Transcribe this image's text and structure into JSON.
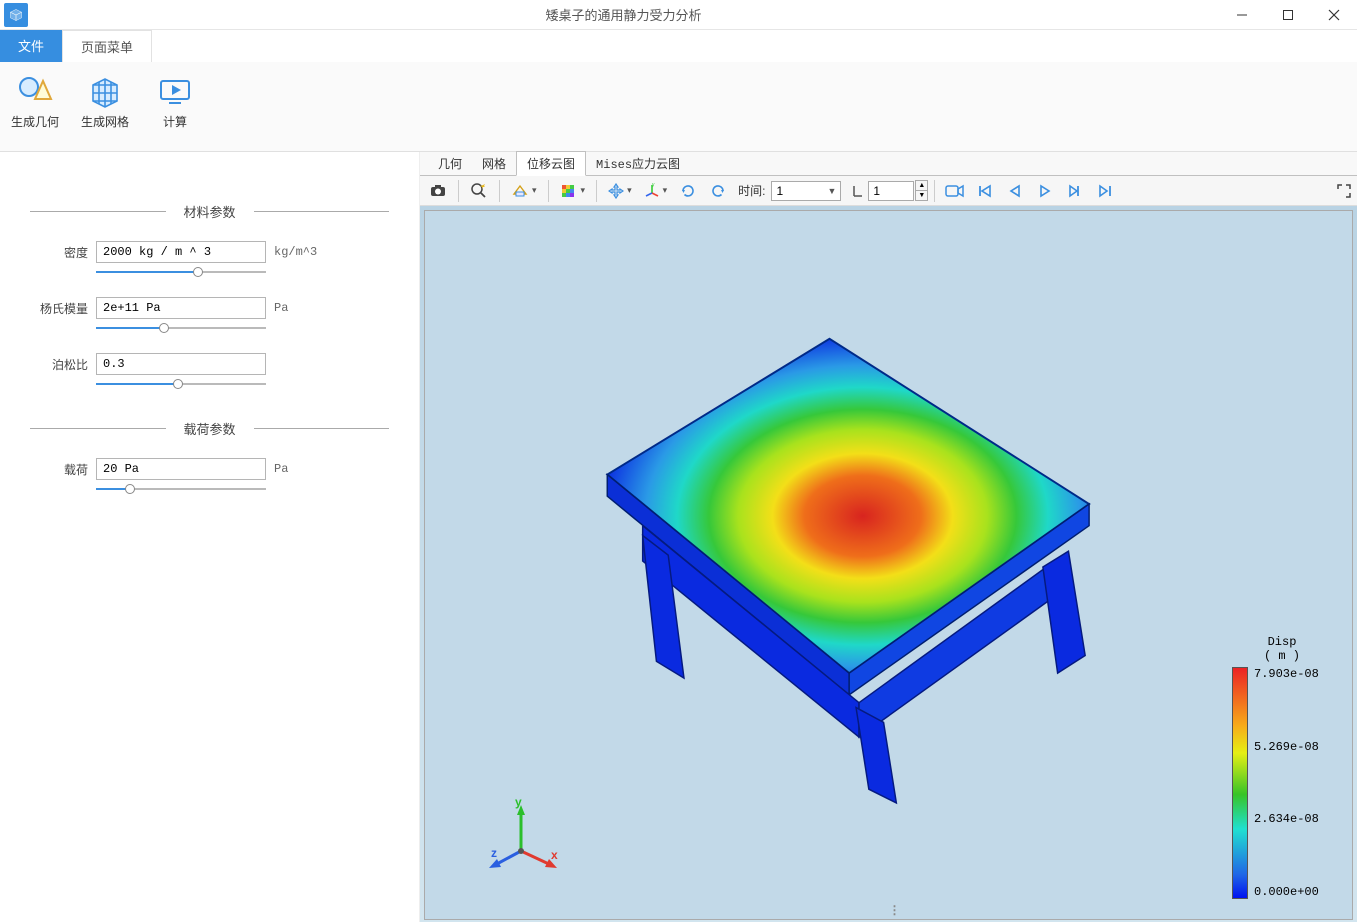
{
  "window": {
    "title": "矮桌子的通用静力受力分析"
  },
  "menu": {
    "file": "文件",
    "page": "页面菜单"
  },
  "ribbon": {
    "geom": "生成几何",
    "mesh": "生成网格",
    "compute": "计算"
  },
  "panel": {
    "materials_header": "材料参数",
    "loads_header": "载荷参数",
    "density": {
      "label": "密度",
      "value": "2000 kg / m ^ 3",
      "unit": "kg/m^3",
      "pct": 60
    },
    "youngs": {
      "label": "杨氏模量",
      "value": "2e+11 Pa",
      "unit": "Pa",
      "pct": 40
    },
    "poisson": {
      "label": "泊松比",
      "value": "0.3",
      "unit": "",
      "pct": 48
    },
    "load": {
      "label": "载荷",
      "value": "20 Pa",
      "unit": "Pa",
      "pct": 20
    }
  },
  "viewtabs": {
    "geom": "几何",
    "mesh": "网格",
    "disp": "位移云图",
    "mises": "Mises应力云图",
    "active": "disp"
  },
  "toolbar": {
    "time_label": "时间:",
    "time_value": "1",
    "frame_value": "1"
  },
  "legend": {
    "title1": "Disp",
    "title2": "( m )",
    "ticks": [
      "7.903e-08",
      "5.269e-08",
      "2.634e-08",
      "0.000e+00"
    ]
  },
  "colors": {
    "accent": "#368ee0"
  }
}
